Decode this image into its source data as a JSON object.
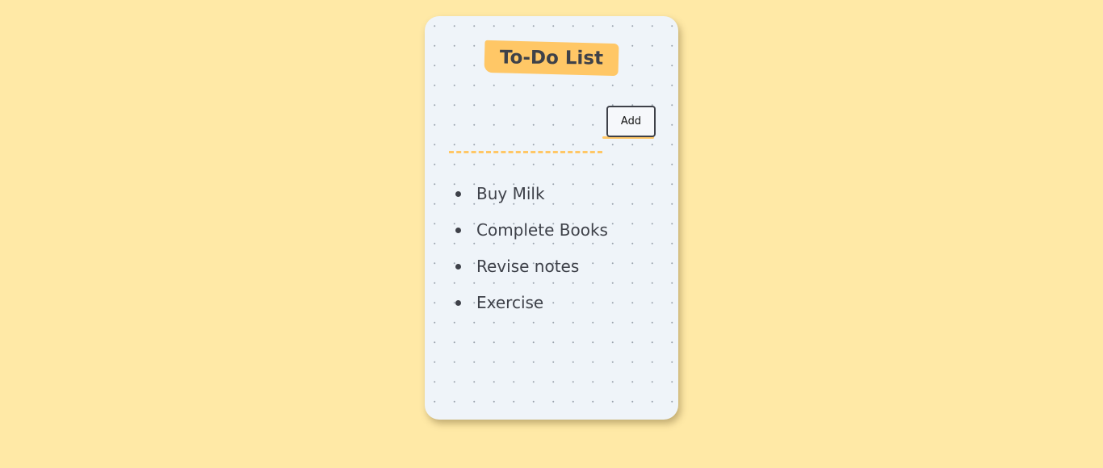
{
  "colors": {
    "page_background": "#ffe9a6",
    "card_background": "#eff4f9",
    "accent": "#ffc766",
    "text": "#3e4149"
  },
  "header": {
    "title": "To-Do List"
  },
  "input": {
    "value": "",
    "placeholder": ""
  },
  "add_button": {
    "label": "Add"
  },
  "tasks": [
    {
      "label": "Buy Milk"
    },
    {
      "label": "Complete Books"
    },
    {
      "label": "Revise notes"
    },
    {
      "label": "Exercise"
    }
  ]
}
